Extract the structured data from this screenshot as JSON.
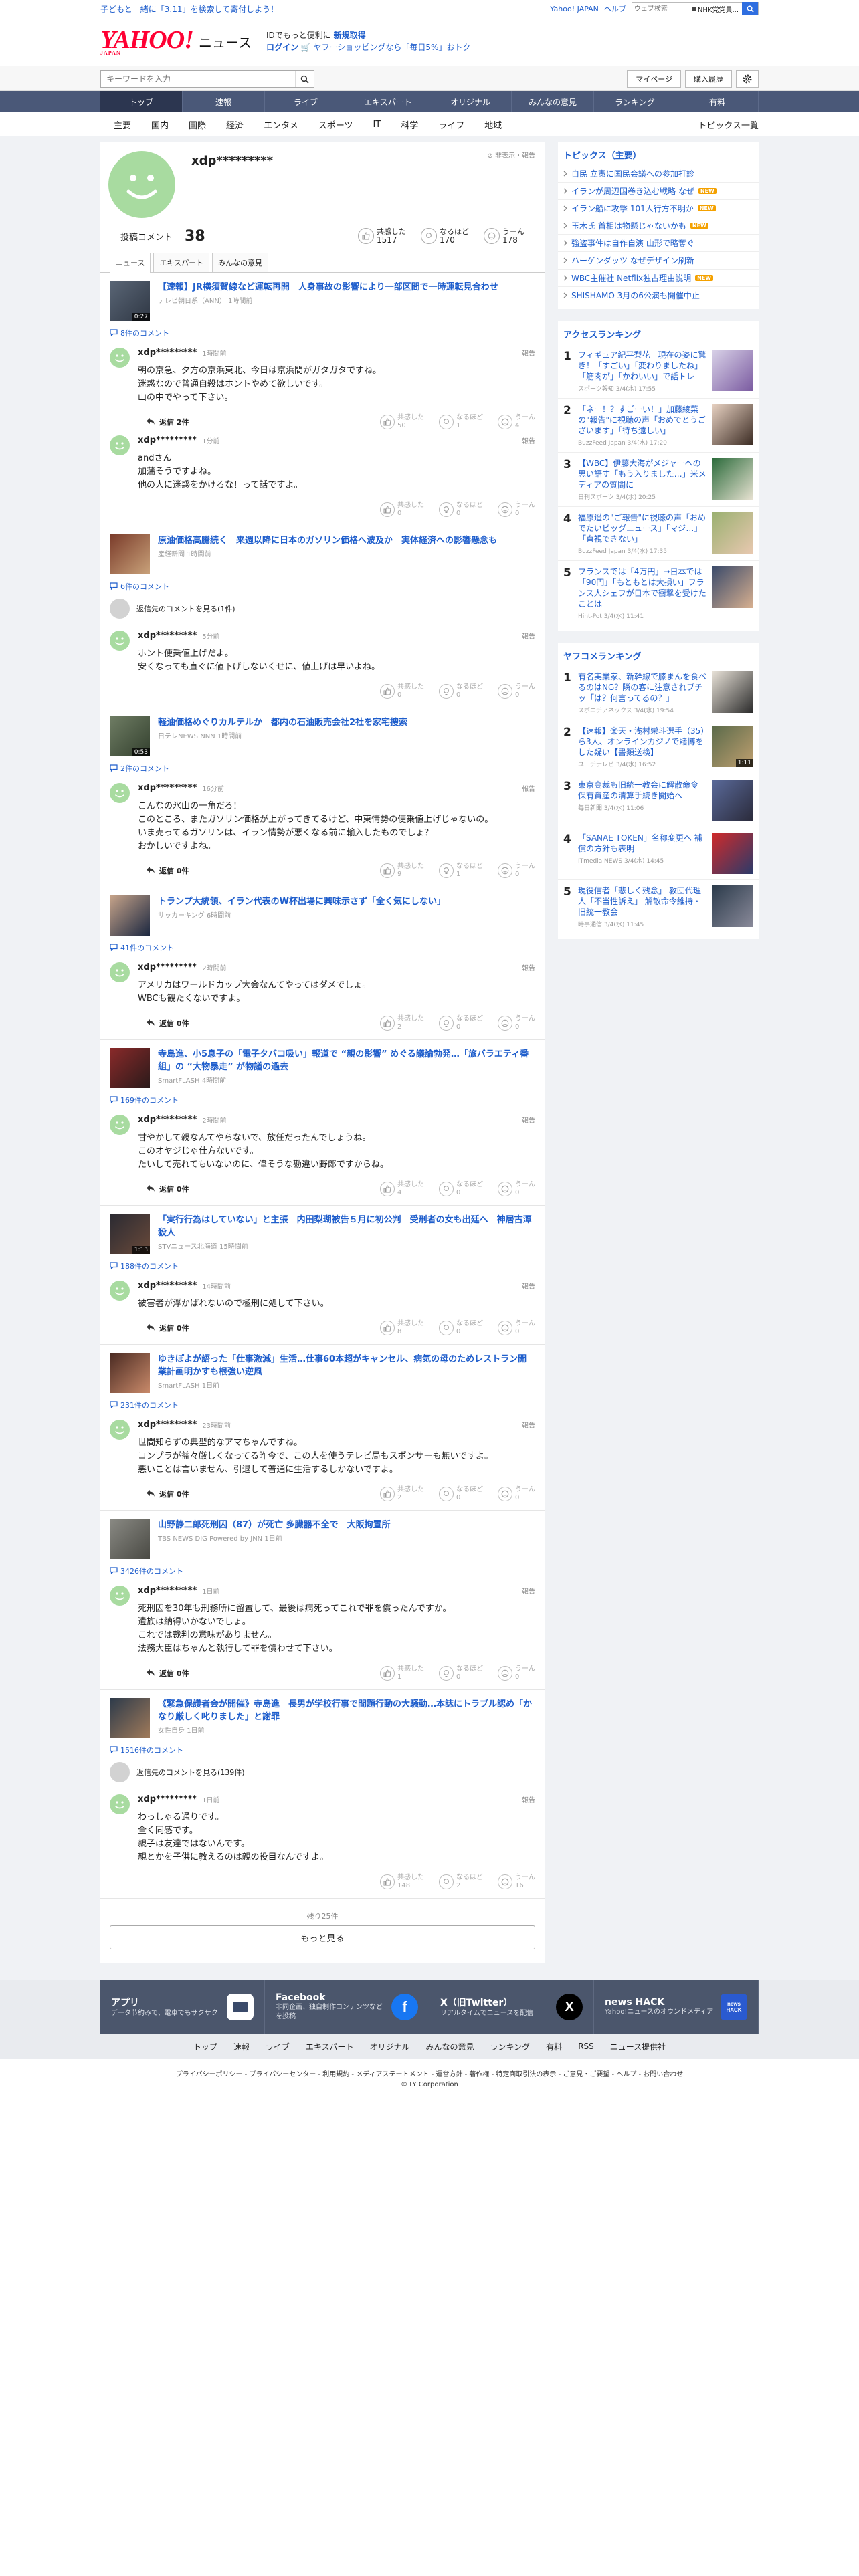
{
  "topbar": {
    "promo": "子どもと一緒に「3.11」を検索して寄付しよう！",
    "links": [
      "Yahoo! JAPAN",
      "ヘルプ"
    ],
    "websearch_placeholder": "ウェブ検索",
    "websearch_option": "NHK党党員..."
  },
  "header": {
    "logo_text": "YAHOO!",
    "logo_sub": "JAPAN",
    "logo_service": "ニュース",
    "info_prefix": "IDでもっと便利に",
    "register": "新規取得",
    "login": "ログイン",
    "shop": "ヤフーショッピングなら「毎日5%」おトク"
  },
  "search": {
    "placeholder": "キーワードを入力",
    "mypage": "マイページ",
    "history": "購入履歴"
  },
  "nav_main": [
    "トップ",
    "速報",
    "ライブ",
    "エキスパート",
    "オリジナル",
    "みんなの意見",
    "ランキング",
    "有料"
  ],
  "nav_sub": [
    "主要",
    "国内",
    "国際",
    "経済",
    "エンタメ",
    "スポーツ",
    "IT",
    "科学",
    "ライフ",
    "地域"
  ],
  "nav_sub_right": "トピックス一覧",
  "profile": {
    "name": "xdp*********",
    "hidden_report": "非表示・報告",
    "comments_label": "投稿コメント",
    "comments_count": "38",
    "stats": [
      {
        "label": "共感した",
        "value": "1517"
      },
      {
        "label": "なるほど",
        "value": "170"
      },
      {
        "label": "うーん",
        "value": "178"
      }
    ],
    "tabs": [
      "ニュース",
      "エキスパート",
      "みんなの意見"
    ]
  },
  "labels": {
    "report": "報告",
    "reactions": [
      "共感した",
      "なるほど",
      "うーん"
    ]
  },
  "articles": [
    {
      "title": "【速報】JR横須賀線など運転再開　人身事故の影響により一部区間で一時運転見合わせ",
      "source": "テレビ朝日系（ANN）",
      "time": "1時間前",
      "video": "0:27",
      "thumb": [
        "#5a6676",
        "#2f3744"
      ],
      "comment_count": "8件のコメント",
      "comments": [
        {
          "name": "xdp*********",
          "time": "1時間前",
          "text": "朝の京急、夕方の京浜東北、今日は京浜間がガタガタですね。\n迷惑なので普通自殺はホントやめて欲しいです。\n山の中でやって下さい。",
          "reply": "返信 2件",
          "reacts": [
            "50",
            "1",
            "4"
          ]
        },
        {
          "name": "xdp*********",
          "time": "1分前",
          "text": "andさん\n加蒲そうですよね。\n他の人に迷惑をかけるな！って話ですよ。",
          "reply": "",
          "reacts": [
            "0",
            "0",
            "0"
          ]
        }
      ]
    },
    {
      "title": "原油価格高騰続く　来週以降に日本のガソリン価格へ波及か　実体経済への影響懸念も",
      "source": "産経新聞",
      "time": "1時間前",
      "video": "",
      "thumb": [
        "#7a3b2a",
        "#c9a27a"
      ],
      "comment_count": "6件のコメント",
      "parent_note": "返信先のコメントを見る(1件)",
      "comments": [
        {
          "name": "xdp*********",
          "time": "5分前",
          "text": "ホント便乗値上げだよ。\n安くなっても直ぐに値下げしないくせに、値上げは早いよね。",
          "reply": "",
          "reacts": [
            "0",
            "0",
            "0"
          ]
        }
      ]
    },
    {
      "title": "軽油価格めぐりカルテルか　都内の石油販売会社2社を家宅捜索",
      "source": "日テレNEWS NNN",
      "time": "1時間前",
      "video": "0:53",
      "thumb": [
        "#6f7d64",
        "#33402e"
      ],
      "comment_count": "2件のコメント",
      "comments": [
        {
          "name": "xdp*********",
          "time": "16分前",
          "text": "こんなの氷山の一角だろ！\nこのところ、またガソリン価格が上がってきてるけど、中東情勢の便乗値上げじゃないの。\nいま売ってるガソリンは、イラン情勢が悪くなる前に輸入したものでしょ？\nおかしいですよね。",
          "reply": "返信 0件",
          "reacts": [
            "9",
            "1",
            "0"
          ]
        }
      ]
    },
    {
      "title": "トランプ大統領、イラン代表のW杯出場に興味示さず「全く気にしない」",
      "source": "サッカーキング",
      "time": "6時間前",
      "video": "",
      "thumb": [
        "#c7a48a",
        "#1b2740"
      ],
      "comment_count": "41件のコメント",
      "comments": [
        {
          "name": "xdp*********",
          "time": "2時間前",
          "text": "アメリカはワールドカップ大会なんてやってはダメでしょ。\nWBCも観たくないですよ。",
          "reply": "返信 0件",
          "reacts": [
            "2",
            "0",
            "0"
          ]
        }
      ]
    },
    {
      "title": "寺島進、小5息子の「電子タバコ吸い」報道で “親の影響” めぐる議論勃発…「旅バラエティ番組」の “大物暴走” が物議の過去",
      "source": "SmartFLASH",
      "time": "4時間前",
      "video": "",
      "thumb": [
        "#8a2a2a",
        "#2a1a1a"
      ],
      "comment_count": "169件のコメント",
      "comments": [
        {
          "name": "xdp*********",
          "time": "2時間前",
          "text": "甘やかして親なんてやらないで、放任だったんでしょうね。\nこのオヤジじゃ仕方ないです。\nたいして売れてもいないのに、偉そうな勘違い野郎ですからね。",
          "reply": "返信 0件",
          "reacts": [
            "4",
            "0",
            "0"
          ]
        }
      ]
    },
    {
      "title": "「実行行為はしていない」と主張　内田梨瑚被告５月に初公判　受刑者の女も出廷へ　神居古潭殺人",
      "source": "STVニュース北海道",
      "time": "15時間前",
      "video": "1:13",
      "thumb": [
        "#2a2a32",
        "#6a4a3a"
      ],
      "comment_count": "188件のコメント",
      "comments": [
        {
          "name": "xdp*********",
          "time": "14時間前",
          "text": "被害者が浮かばれないので極刑に処して下さい。",
          "reply": "返信 0件",
          "reacts": [
            "8",
            "0",
            "0"
          ]
        }
      ]
    },
    {
      "title": "ゆきぽよが語った「仕事激減」生活…仕事60本超がキャンセル、病気の母のためレストラン開業計画明かすも根強い逆風",
      "source": "SmartFLASH",
      "time": "1日前",
      "video": "",
      "thumb": [
        "#4a2a22",
        "#c98a6a"
      ],
      "comment_count": "231件のコメント",
      "comments": [
        {
          "name": "xdp*********",
          "time": "23時間前",
          "text": "世間知らずの典型的なアマちゃんですね。\nコンプラが益々厳しくなってる昨今で、この人を使うテレビ局もスポンサーも無いですよ。\n悪いことは言いません、引退して普通に生活するしかないですよ。",
          "reply": "返信 0件",
          "reacts": [
            "2",
            "0",
            "0"
          ]
        }
      ]
    },
    {
      "title": "山野静二郎死刑囚（87）が死亡 多臓器不全で　大阪拘置所",
      "source": "TBS NEWS DIG Powered by JNN",
      "time": "1日前",
      "video": "",
      "thumb": [
        "#8a8a84",
        "#4a4a44"
      ],
      "comment_count": "3426件のコメント",
      "comments": [
        {
          "name": "xdp*********",
          "time": "1日前",
          "text": "死刑囚を30年も刑務所に留置して、最後は病死ってこれで罪を償ったんですか。\n遺族は納得いかないでしょ。\nこれでは裁判の意味がありません。\n法務大臣はちゃんと執行して罪を償わせて下さい。",
          "reply": "返信 0件",
          "reacts": [
            "1",
            "0",
            "0"
          ]
        }
      ]
    },
    {
      "title": "《緊急保護者会が開催》寺島進　長男が学校行事で問題行動の大騒動…本誌にトラブル認め「かなり厳しく叱りました」と謝罪",
      "source": "女性自身",
      "time": "1日前",
      "video": "",
      "thumb": [
        "#2c3a4a",
        "#a07a5a"
      ],
      "comment_count": "1516件のコメント",
      "parent_note": "返信先のコメントを見る(139件)",
      "comments": [
        {
          "name": "xdp*********",
          "time": "1日前",
          "text": "わっしゃる通りです。\n全く同感です。\n親子は友達ではないんです。\n親とかを子供に教えるのは親の役目なんですよ。",
          "reply": "",
          "reacts": [
            "148",
            "2",
            "16"
          ]
        }
      ]
    }
  ],
  "more": {
    "remaining": "残り25件",
    "button": "もっと見る"
  },
  "topics": {
    "title": "トピックス（主要）",
    "items": [
      {
        "text": "自民 立憲に国民会議への参加打診",
        "new": ""
      },
      {
        "text": "イランが周辺国巻き込む戦略 なぜ",
        "new": "NEW"
      },
      {
        "text": "イラン船に攻撃 101人行方不明か",
        "new": "NEW"
      },
      {
        "text": "玉木氏 首相は物懸じゃないかも",
        "new": "NEW"
      },
      {
        "text": "強盗事件は自作自演 山形で略奪ぐ",
        "new": ""
      },
      {
        "text": "ハーゲンダッツ なぜデザイン刷新",
        "new": ""
      },
      {
        "text": "WBC主催社 Netflix独占理由説明",
        "new": "NEW"
      },
      {
        "text": "SHISHAMO 3月の6公演も開催中止",
        "new": ""
      }
    ]
  },
  "access_ranking": {
    "title": "アクセスランキング",
    "items": [
      {
        "title": "フィギュア紀平梨花　現在の姿に驚き！「すごい」「変わりましたね」「筋肉が」「かわいい」で話トレ",
        "source": "スポーツ報知",
        "time": "3/4(水) 17:55",
        "thumb": [
          "#d9d2e8",
          "#7a5aa0"
        ]
      },
      {
        "title": "「ネー！？すごーい！」加藤綾菜の\"報告\"に視聴の声「おめでとうございます」「待ち遠しい」",
        "source": "BuzzFeed Japan",
        "time": "3/4(水) 17:20",
        "thumb": [
          "#e8d2c2",
          "#3a2a22"
        ]
      },
      {
        "title": "【WBC】伊藤大海がメジャーへの思い語す「もう入りました…」米メディアの質問に",
        "source": "日刊スポーツ",
        "time": "3/4(水) 20:25",
        "thumb": [
          "#2a6a3a",
          "#e8e2d2"
        ]
      },
      {
        "title": "福原遥の\"ご報告\"に視聴の声「おめでたいビッグニュース」「マジ…」「直視できない」",
        "source": "BuzzFeed Japan",
        "time": "3/4(水) 17:35",
        "thumb": [
          "#9ab070",
          "#e8c8b0"
        ]
      },
      {
        "title": "フランスでは「4万円」→日本では「90円」「もともとは大損い」フランス人シェフが日本で衝撃を受けたことは",
        "source": "Hint-Pot",
        "time": "3/4(水) 11:41",
        "thumb": [
          "#3a4a6a",
          "#d8b090"
        ]
      }
    ]
  },
  "yahoo_ranking": {
    "title": "ヤフコメランキング",
    "items": [
      {
        "title": "有名実業家、新幹線で膝まんを食べるのはNG？隣の客に注意されプチッ「は？何言ってるの？」",
        "source": "スポニチアネックス",
        "time": "3/4(水) 19:54",
        "video": "",
        "thumb": [
          "#e8e2d8",
          "#2a2a2a"
        ]
      },
      {
        "title": "【速報】楽天・浅村栄斗選手（35）ら3人、オンラインカジノで賭博をした疑い【書類送検】",
        "source": "ユーチテレビ",
        "time": "3/4(水) 16:52",
        "video": "1:11",
        "thumb": [
          "#5a6a4a",
          "#c0a070"
        ]
      },
      {
        "title": "東京高裁も旧統一教会に解散命令 保有資産の清算手続き開始へ",
        "source": "毎日新聞",
        "time": "3/4(水) 11:06",
        "video": "",
        "thumb": [
          "#5a6a9a",
          "#2a2a3a"
        ]
      },
      {
        "title": "「SANAE TOKEN」名称変更へ 補償の方針も表明",
        "source": "ITmedia NEWS",
        "time": "3/4(水) 14:45",
        "video": "",
        "thumb": [
          "#d02a2a",
          "#2a3a6a"
        ]
      },
      {
        "title": "現役信者「悲しく残念」 教団代理人「不当性訴え」 解散命令維持・旧統一教会",
        "source": "時事通信",
        "time": "3/4(水) 11:45",
        "video": "",
        "thumb": [
          "#2a3a4a",
          "#8a8a9a"
        ]
      }
    ]
  },
  "footer": {
    "apps": [
      {
        "title": "アプリ",
        "desc": "データ节約みで、電車でもサクサク",
        "icon": "app-icon"
      },
      {
        "title": "Facebook",
        "desc": "非同企画、独自制作コンテンツなどを投稿",
        "icon": "facebook-icon"
      },
      {
        "title": "X（旧Twitter）",
        "desc": "リアルタイムでニュースを配信",
        "icon": "x-icon"
      },
      {
        "title": "news HACK",
        "desc": "Yahoo!ニュースのオウンドメディア",
        "icon": "newshack-icon"
      }
    ],
    "links": [
      "トップ",
      "速報",
      "ライブ",
      "エキスパート",
      "オリジナル",
      "みんなの意見",
      "ランキング",
      "有料",
      "RSS",
      "ニュース提供社"
    ],
    "legal": "プライバシーポリシー - プライバシーセンター - 利用規約 - メディアステートメント - 運営方針 - 著作権 - 特定商取引法の表示 - ご意見・ご要望 - ヘルプ - お問い合わせ",
    "copyright": "© LY Corporation"
  }
}
